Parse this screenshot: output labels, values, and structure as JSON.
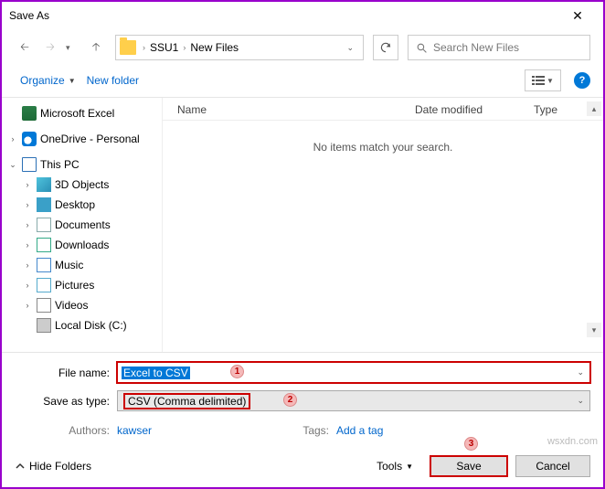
{
  "title": "Save As",
  "breadcrumb": {
    "p1": "SSU1",
    "p2": "New Files"
  },
  "search_placeholder": "Search New Files",
  "toolbar": {
    "organize": "Organize",
    "new_folder": "New folder"
  },
  "sidebar": {
    "excel": "Microsoft Excel",
    "onedrive": "OneDrive - Personal",
    "thispc": "This PC",
    "objects3d": "3D Objects",
    "desktop": "Desktop",
    "documents": "Documents",
    "downloads": "Downloads",
    "music": "Music",
    "pictures": "Pictures",
    "videos": "Videos",
    "localdisk": "Local Disk (C:)"
  },
  "columns": {
    "name": "Name",
    "date": "Date modified",
    "type": "Type"
  },
  "empty_msg": "No items match your search.",
  "field": {
    "filename_label": "File name:",
    "filename_value": "Excel to CSV",
    "saveas_label": "Save as type:",
    "saveas_value": "CSV (Comma delimited)",
    "authors_label": "Authors:",
    "authors_value": "kawser",
    "tags_label": "Tags:",
    "tags_value": "Add a tag"
  },
  "footer": {
    "hide": "Hide Folders",
    "tools": "Tools",
    "save": "Save",
    "cancel": "Cancel"
  },
  "badges": {
    "b1": "1",
    "b2": "2",
    "b3": "3"
  },
  "watermark": "wsxdn.com"
}
